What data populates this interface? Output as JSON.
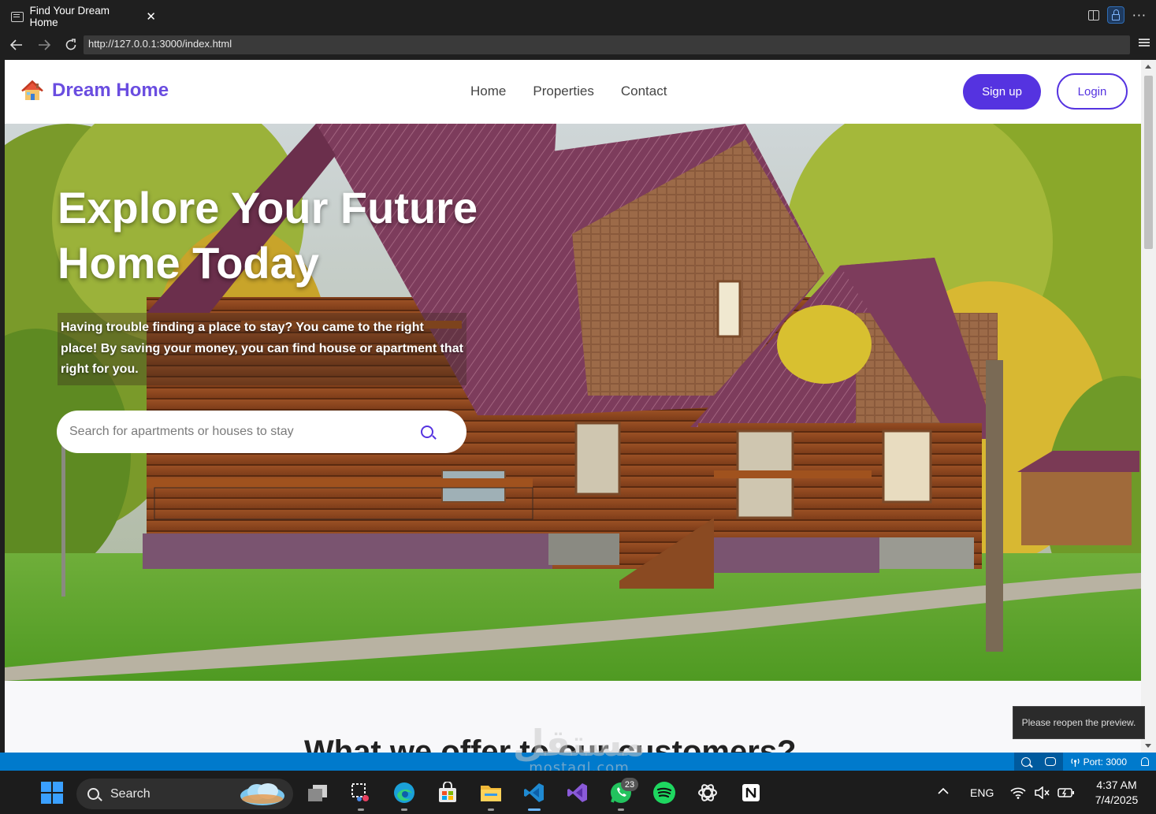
{
  "browser": {
    "tab_title": "Find Your Dream Home",
    "tab_close": "✕",
    "url": "http://127.0.0.1:3000/index.html",
    "more_label": "···"
  },
  "site": {
    "logo_text": "Dream Home",
    "nav": [
      "Home",
      "Properties",
      "Contact"
    ],
    "signup_label": "Sign up",
    "login_label": "Login"
  },
  "hero": {
    "title": "Explore Your Future Home Today",
    "description": "Having trouble finding a place to stay? You came to the right place! By saving your money, you can find house or apartment that right for you.",
    "search_placeholder": "Search for apartments or houses to stay"
  },
  "section": {
    "heading_partial": "What we offer to our customers?"
  },
  "toast": "Please reopen the preview.",
  "statusbar": {
    "port": "Port: 3000"
  },
  "watermark": {
    "arabic": "مستقل",
    "latin": "mostaql.com"
  },
  "taskbar": {
    "search_label": "Search",
    "whatsapp_badge": "23",
    "language": "ENG",
    "time": "4:37 AM",
    "date": "7/4/2025"
  },
  "colors": {
    "brand": "#5533e0",
    "statusbar": "#007acc",
    "chrome": "#1f1f1f"
  }
}
